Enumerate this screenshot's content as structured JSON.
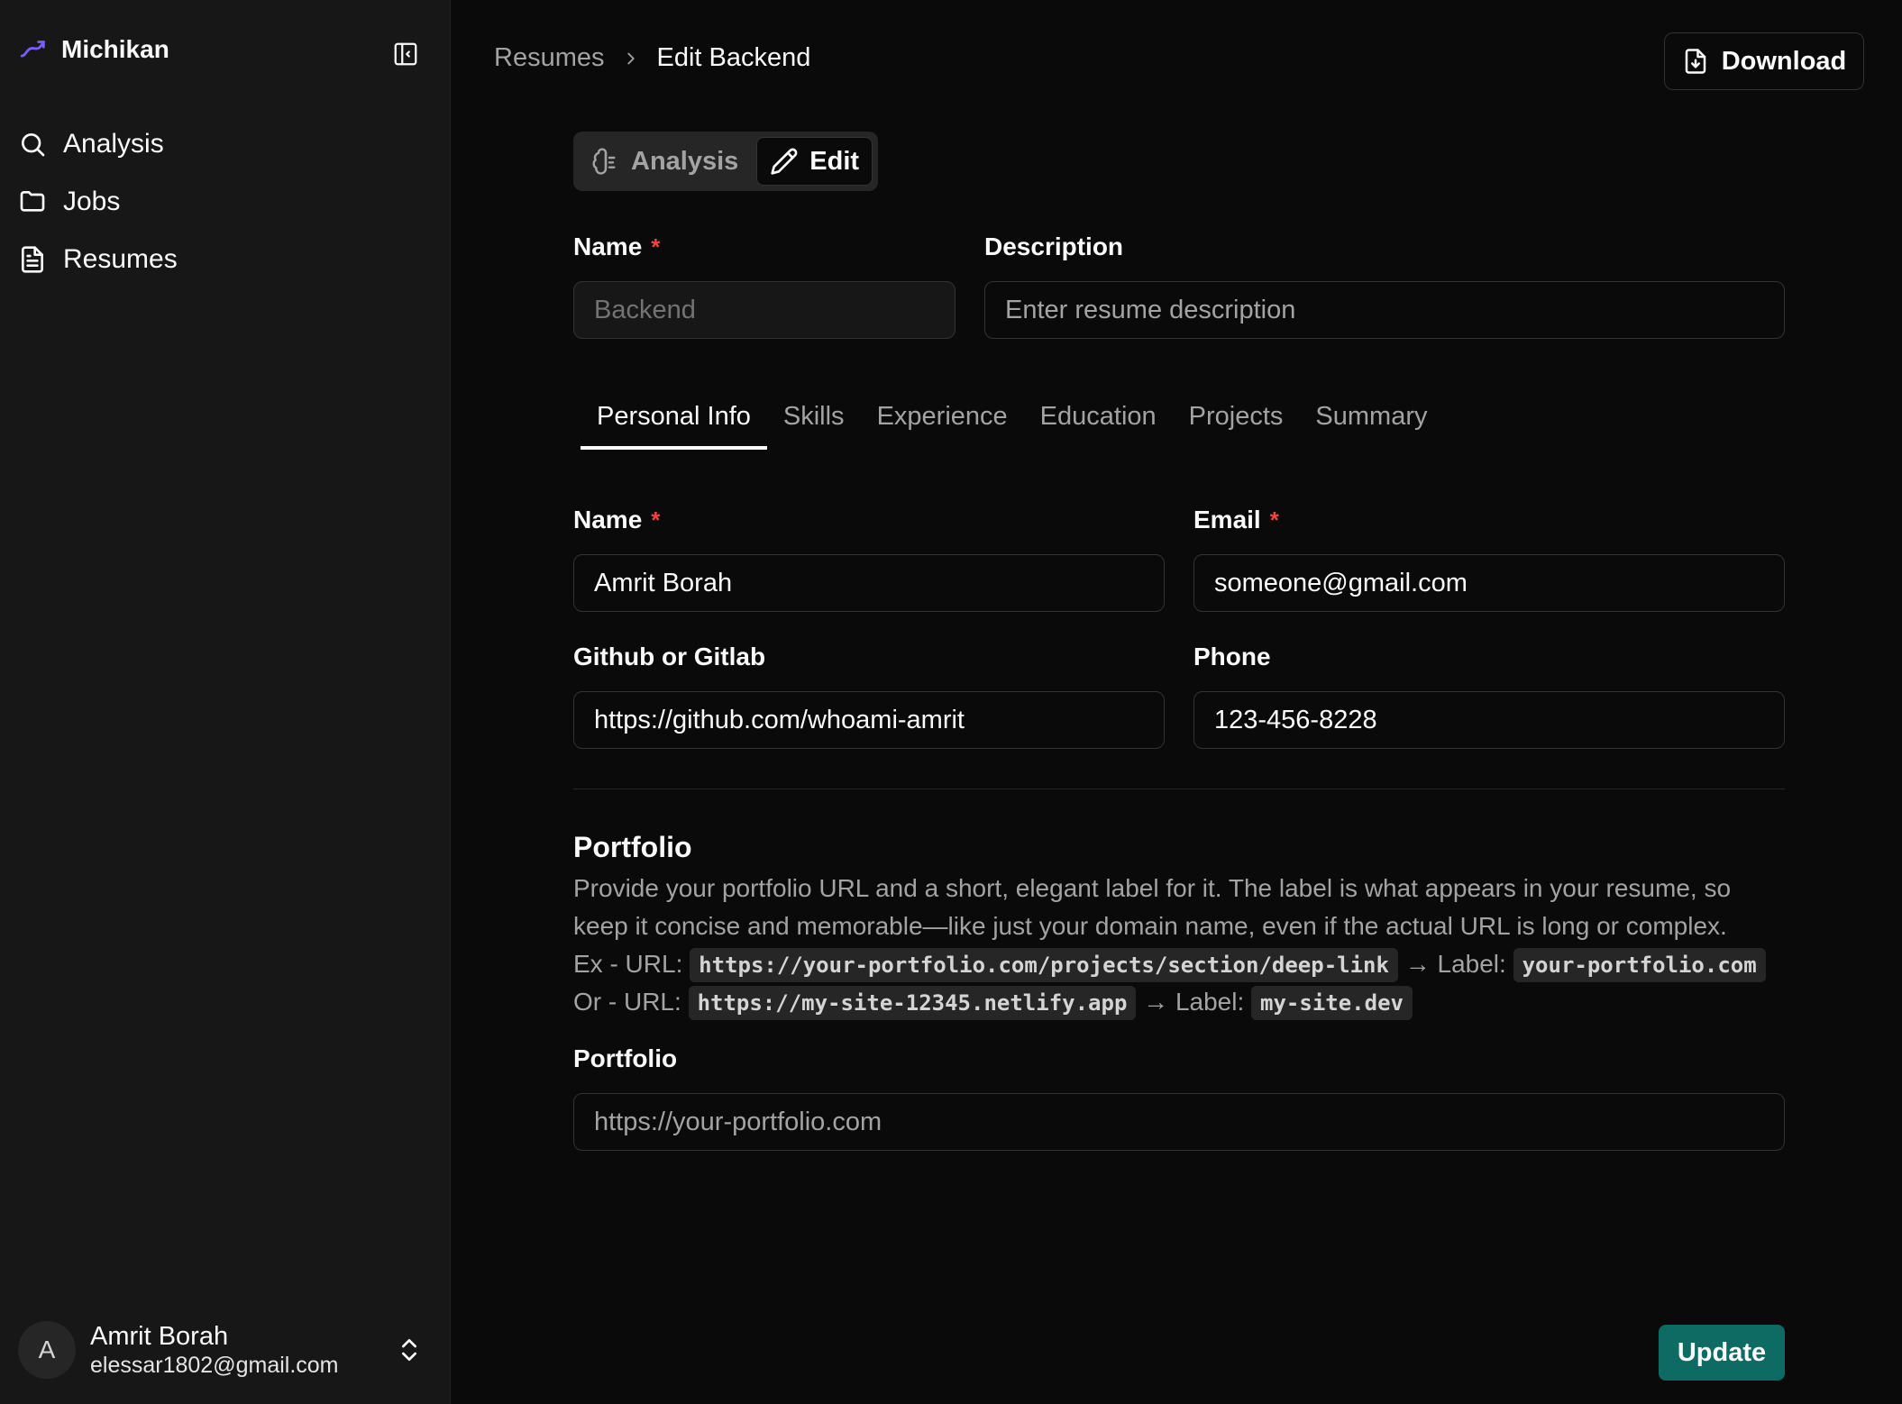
{
  "colors": {
    "brand_accent": "#7c5cff",
    "required_star": "#ef4444",
    "update_button": "#0d6b63"
  },
  "sidebar": {
    "app_name": "Michikan",
    "items": [
      {
        "label": "Analysis",
        "icon": "search-icon"
      },
      {
        "label": "Jobs",
        "icon": "folder-icon"
      },
      {
        "label": "Resumes",
        "icon": "file-text-icon"
      }
    ],
    "user": {
      "initial": "A",
      "name": "Amrit Borah",
      "email": "elessar1802@gmail.com"
    }
  },
  "header": {
    "breadcrumb_root": "Resumes",
    "breadcrumb_current": "Edit Backend",
    "download_label": "Download"
  },
  "mode_toggle": {
    "analysis_label": "Analysis",
    "edit_label": "Edit",
    "active": "Edit"
  },
  "resume_meta": {
    "name_label": "Name",
    "name_required": "*",
    "name_value": "Backend",
    "description_label": "Description",
    "description_placeholder": "Enter resume description"
  },
  "tabs": [
    "Personal Info",
    "Skills",
    "Experience",
    "Education",
    "Projects",
    "Summary"
  ],
  "active_tab": "Personal Info",
  "personal_info": {
    "name_label": "Name",
    "name_value": "Amrit Borah",
    "email_label": "Email",
    "email_value": "someone@gmail.com",
    "github_label": "Github or Gitlab",
    "github_value": "https://github.com/whoami-amrit",
    "phone_label": "Phone",
    "phone_value": "123-456-8228",
    "required_mark": "*"
  },
  "portfolio": {
    "title": "Portfolio",
    "description": "Provide your portfolio URL and a short, elegant label for it. The label is what appears in your resume, so keep it concise and memorable—like just your domain name, even if the actual URL is long or complex.",
    "ex_prefix": "Ex - URL:",
    "ex_url": "https://your-portfolio.com/projects/section/deep-link",
    "ex_arrow_label": "→ Label:",
    "ex_label": "your-portfolio.com",
    "or_prefix": "Or - URL:",
    "or_url": "https://my-site-12345.netlify.app",
    "or_arrow_label": "→ Label:",
    "or_label": "my-site.dev",
    "field_label": "Portfolio",
    "field_placeholder": "https://your-portfolio.com"
  },
  "footer": {
    "update_label": "Update"
  }
}
